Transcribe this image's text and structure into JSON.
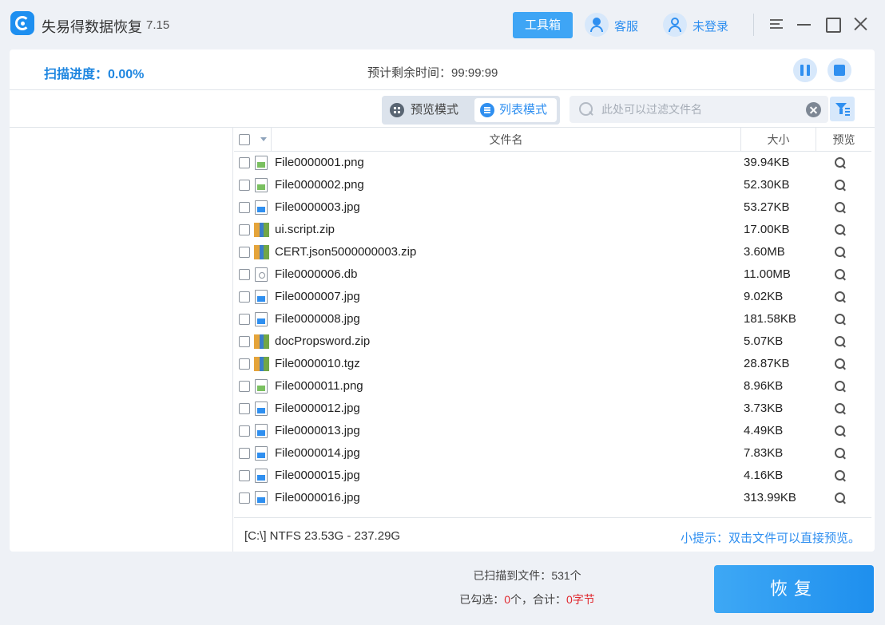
{
  "app": {
    "name": "失易得数据恢复",
    "version": "7.15"
  },
  "titlebar": {
    "toolbox_label": "工具箱",
    "service_label": "客服",
    "login_label": "未登录"
  },
  "scan": {
    "progress_label": "扫描进度：0.00%",
    "remaining_label": "预计剩余时间：99:99:99"
  },
  "view": {
    "preview_mode_label": "预览模式",
    "list_mode_label": "列表模式",
    "active_mode": "list"
  },
  "search": {
    "placeholder": "此处可以过滤文件名",
    "value": ""
  },
  "table": {
    "columns": {
      "name": "文件名",
      "size": "大小",
      "preview": "预览"
    },
    "rows": [
      {
        "name": "File0000001.png",
        "size": "39.94KB",
        "icon": "png-file-icon"
      },
      {
        "name": "File0000002.png",
        "size": "52.30KB",
        "icon": "png-file-icon"
      },
      {
        "name": "File0000003.jpg",
        "size": "53.27KB",
        "icon": "jpg-file-icon"
      },
      {
        "name": "ui.script.zip",
        "size": "17.00KB",
        "icon": "zip-archive-icon"
      },
      {
        "name": "CERT.json5000000003.zip",
        "size": "3.60MB",
        "icon": "zip-archive-icon"
      },
      {
        "name": "File0000006.db",
        "size": "11.00MB",
        "icon": "db-file-icon"
      },
      {
        "name": "File0000007.jpg",
        "size": "9.02KB",
        "icon": "jpg-file-icon"
      },
      {
        "name": "File0000008.jpg",
        "size": "181.58KB",
        "icon": "jpg-file-icon"
      },
      {
        "name": "docPropsword.zip",
        "size": "5.07KB",
        "icon": "zip-archive-icon"
      },
      {
        "name": "File0000010.tgz",
        "size": "28.87KB",
        "icon": "tgz-archive-icon"
      },
      {
        "name": "File0000011.png",
        "size": "8.96KB",
        "icon": "png-file-icon"
      },
      {
        "name": "File0000012.jpg",
        "size": "3.73KB",
        "icon": "jpg-file-icon"
      },
      {
        "name": "File0000013.jpg",
        "size": "4.49KB",
        "icon": "jpg-file-icon"
      },
      {
        "name": "File0000014.jpg",
        "size": "7.83KB",
        "icon": "jpg-file-icon"
      },
      {
        "name": "File0000015.jpg",
        "size": "4.16KB",
        "icon": "jpg-file-icon"
      },
      {
        "name": "File0000016.jpg",
        "size": "313.99KB",
        "icon": "jpg-file-icon"
      }
    ]
  },
  "status": {
    "drive_info": "[C:\\] NTFS 23.53G - 237.29G",
    "tip": "小提示：双击文件可以直接预览。"
  },
  "footer": {
    "scanned_prefix": "已扫描到文件：",
    "scanned_count": "531个",
    "selected_prefix": "已勾选：",
    "selected_count": "0",
    "selected_mid": "个，合计：",
    "selected_bytes": "0字节",
    "recover_label": "恢复"
  },
  "colors": {
    "accent": "#2f8ff0",
    "warning": "#e0282e",
    "background": "#eef1f6"
  }
}
